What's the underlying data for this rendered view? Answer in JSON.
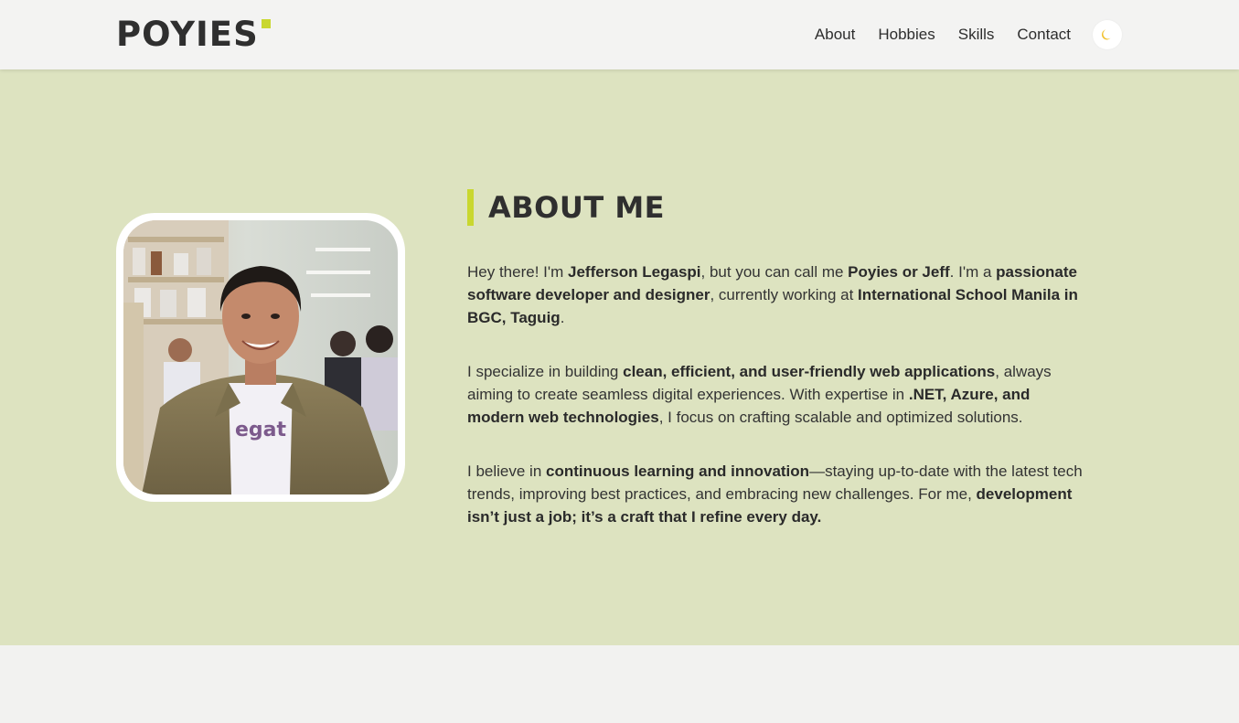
{
  "header": {
    "logo_text": "POYIES",
    "nav": [
      {
        "label": "About"
      },
      {
        "label": "Hobbies"
      },
      {
        "label": "Skills"
      },
      {
        "label": "Contact"
      }
    ],
    "theme_toggle_icon": "moon-icon"
  },
  "about": {
    "heading": "ABOUT ME",
    "paragraphs": [
      {
        "p1_a": "Hey there! I'm ",
        "p1_b": "Jefferson Legaspi",
        "p1_c": ", but you can call me ",
        "p1_d": "Poyies or Jeff",
        "p1_e": ". I'm a ",
        "p1_f": "passionate software developer and designer",
        "p1_g": ", currently working at ",
        "p1_h": "International School Manila in BGC, Taguig",
        "p1_i": "."
      },
      {
        "p2_a": "I specialize in building ",
        "p2_b": "clean, efficient, and user-friendly web applications",
        "p2_c": ", always aiming to create seamless digital experiences. With expertise in ",
        "p2_d": ".NET, Azure, and modern web technologies",
        "p2_e": ", I focus on crafting scalable and optimized solutions."
      },
      {
        "p3_a": "I believe in ",
        "p3_b": "continuous learning and innovation",
        "p3_c": "—staying up-to-date with the latest tech trends, improving best practices, and embracing new challenges. For me, ",
        "p3_d": "development isn’t just a job; it’s a craft that I refine every day."
      }
    ]
  },
  "colors": {
    "accent": "#c9d72f",
    "section_bg": "#dde3c0",
    "page_bg": "#f2f2f0",
    "text": "#2b2b2b"
  }
}
